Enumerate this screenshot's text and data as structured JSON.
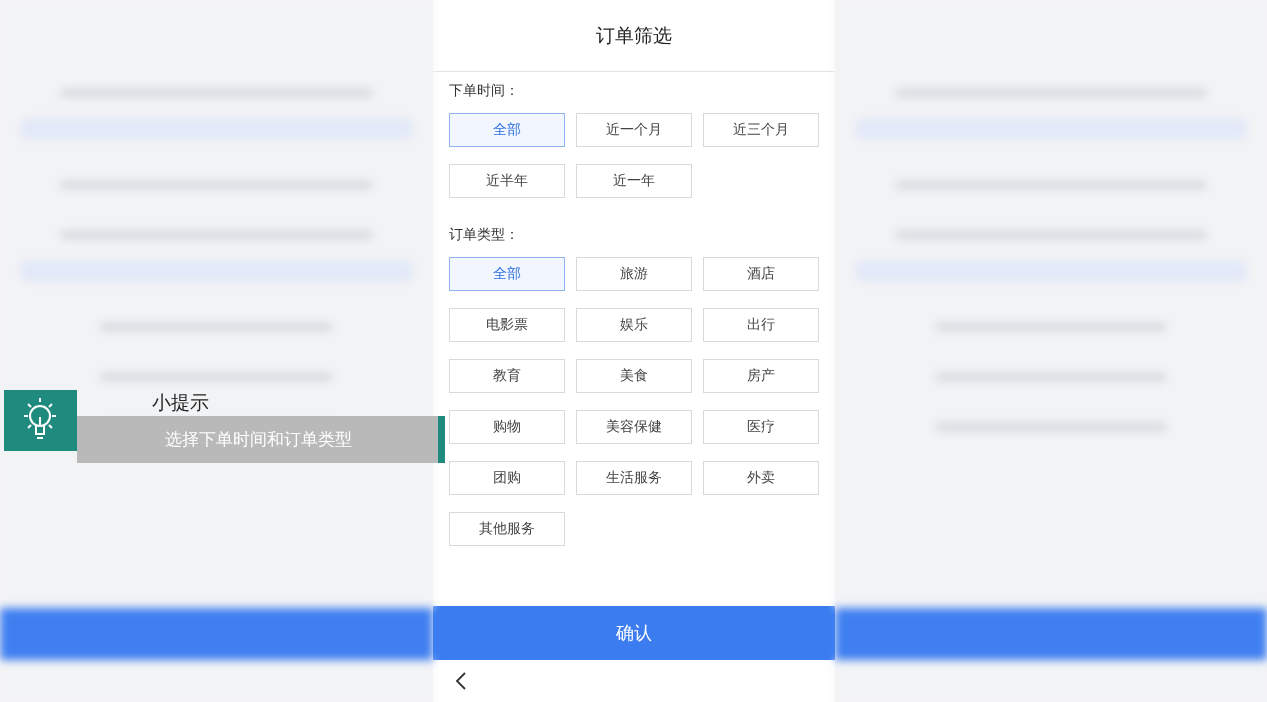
{
  "title": "订单筛选",
  "sections": [
    {
      "label": "下单时间：",
      "options": [
        {
          "label": "全部",
          "selected": true
        },
        {
          "label": "近一个月",
          "selected": false
        },
        {
          "label": "近三个月",
          "selected": false
        },
        {
          "label": "近半年",
          "selected": false
        },
        {
          "label": "近一年",
          "selected": false
        }
      ]
    },
    {
      "label": "订单类型：",
      "options": [
        {
          "label": "全部",
          "selected": true
        },
        {
          "label": "旅游",
          "selected": false
        },
        {
          "label": "酒店",
          "selected": false
        },
        {
          "label": "电影票",
          "selected": false
        },
        {
          "label": "娱乐",
          "selected": false
        },
        {
          "label": "出行",
          "selected": false
        },
        {
          "label": "教育",
          "selected": false
        },
        {
          "label": "美食",
          "selected": false
        },
        {
          "label": "房产",
          "selected": false
        },
        {
          "label": "购物",
          "selected": false
        },
        {
          "label": "美容保健",
          "selected": false
        },
        {
          "label": "医疗",
          "selected": false
        },
        {
          "label": "团购",
          "selected": false
        },
        {
          "label": "生活服务",
          "selected": false
        },
        {
          "label": "外卖",
          "selected": false
        },
        {
          "label": "其他服务",
          "selected": false
        }
      ]
    }
  ],
  "confirm": "确认",
  "tip": {
    "title": "小提示",
    "text": "选择下单时间和订单类型"
  }
}
